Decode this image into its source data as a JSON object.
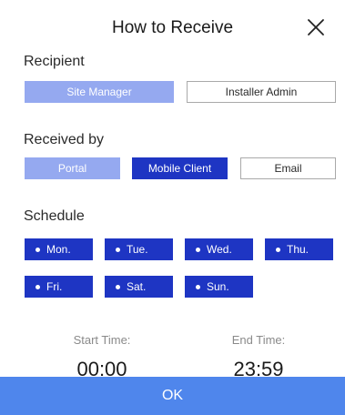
{
  "header": {
    "title": "How to Receive",
    "close_icon": "close-icon"
  },
  "recipient": {
    "label": "Recipient",
    "options": [
      {
        "label": "Site Manager",
        "state": "disabled-selected"
      },
      {
        "label": "Installer Admin",
        "state": "unselected"
      }
    ]
  },
  "received_by": {
    "label": "Received by",
    "options": [
      {
        "label": "Portal",
        "state": "disabled-selected"
      },
      {
        "label": "Mobile Client",
        "state": "selected"
      },
      {
        "label": "Email",
        "state": "unselected"
      }
    ]
  },
  "schedule": {
    "label": "Schedule",
    "days": [
      "Mon.",
      "Tue.",
      "Wed.",
      "Thu.",
      "Fri.",
      "Sat.",
      "Sun."
    ]
  },
  "times": {
    "start_label": "Start Time:",
    "start_value": "00:00",
    "end_label": "End Time:",
    "end_value": "23:59"
  },
  "footer": {
    "ok_label": "OK"
  },
  "colors": {
    "primary": "#1e35c3",
    "primary_light": "#95a9f0",
    "ok_bar": "#4f86ec"
  }
}
